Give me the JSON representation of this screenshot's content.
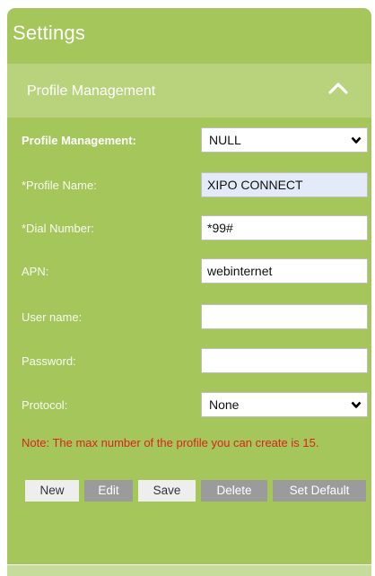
{
  "header": {
    "title": "Settings"
  },
  "section": {
    "title": "Profile Management"
  },
  "form": {
    "profile_management": {
      "label": "Profile Management:",
      "value": "NULL"
    },
    "profile_name": {
      "label": "*Profile Name:",
      "value": "XIPO CONNECT"
    },
    "dial_number": {
      "label": "*Dial Number:",
      "value": "*99#"
    },
    "apn": {
      "label": "APN:",
      "value": "webinternet"
    },
    "user_name": {
      "label": "User name:",
      "value": ""
    },
    "password": {
      "label": "Password:",
      "value": ""
    },
    "protocol": {
      "label": "Protocol:",
      "value": "None"
    }
  },
  "note": "Note: The max number of the profile you can create is 15.",
  "buttons": {
    "new": "New",
    "edit": "Edit",
    "save": "Save",
    "delete": "Delete",
    "set_default": "Set Default"
  },
  "colors": {
    "panel": "#a4c65a",
    "section_header": "#b8d37b",
    "note": "#d9251c",
    "button_disabled": "#9b9b9b"
  },
  "icons": {
    "collapse": "chevron-up-icon",
    "dropdown": "chevron-down-icon"
  }
}
